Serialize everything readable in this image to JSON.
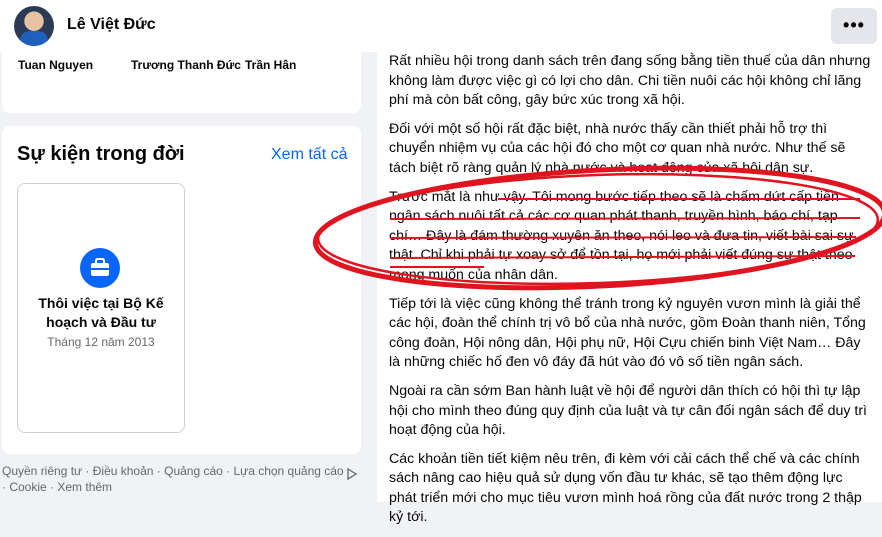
{
  "header": {
    "profile_name": "Lê Việt Đức",
    "more_label": "•••"
  },
  "friends": [
    "Tuan Nguyen",
    "Trương Thanh Đức",
    "Trần Hân"
  ],
  "life_events": {
    "title": "Sự kiện trong đời",
    "see_all": "Xem tất cả",
    "event": {
      "title": "Thôi việc tại Bộ Kế hoạch và Đầu tư",
      "date": "Tháng 12 năm 2013"
    }
  },
  "footer": {
    "line1": "Quyền riêng tư · Điều khoản · Quảng cáo · Lựa chọn quảng cáo",
    "line2": "· Cookie · Xem thêm"
  },
  "article": {
    "p1": "Rất nhiều hội trong danh sách trên đang sống bằng tiền thuế của dân nhưng không làm được việc gì có lợi cho dân. Chi tiền nuôi các hội không chỉ lãng phí mà còn bất công, gây bức xúc trong xã hội.",
    "p2": "Đối với một số hội rất đặc biệt, nhà nước thấy cần thiết phải hỗ trợ thì chuyển nhiệm vụ của các hội đó cho một cơ quan nhà nước. Như thế sẽ tách biệt rõ ràng quản lý nhà nước và hoạt động của xã hội dân sự.",
    "p3": "Trước mắt là như vậy. Tôi mong bước tiếp theo sẽ là chấm dứt cấp tiền ngân sách nuôi tất cả các cơ quan phát thanh, truyền hình, báo chí, tạp chí… Đây là đám thường xuyên ăn theo, nói leo và đưa tin, viết bài sai sự thật. Chỉ khi phải tự xoay sở để tồn tại, họ mới phải viết đúng sự thật theo mong muốn của nhân dân.",
    "p4": "Tiếp tới là việc cũng không thể tránh trong kỷ nguyên vươn mình là giải thể các hội, đoàn thể chính trị vô bổ của nhà nước, gồm Đoàn thanh niên, Tổng công đoàn, Hội nông dân, Hội phụ nữ, Hội Cựu chiến binh Việt Nam… Đây là những chiếc hố đen vô đáy đã hút vào đó vô số tiền ngân sách.",
    "p5": "Ngoài ra cần sớm Ban hành luật về hội để người dân thích có hội thì tự lập hội cho mình theo đúng quy định của luật và tự cân đối ngân sách để duy trì hoạt động của hội.",
    "p6": "Các khoản tiền tiết kiệm nêu trên, đi kèm với cải cách thể chế và các chính sách nâng cao hiệu quả sử dụng vốn đầu tư khác, sẽ tạo thêm động lực phát triển mới cho mục tiêu vươn mình hoá rồng của đất nước trong 2 thập kỷ tới."
  },
  "colors": {
    "accent": "#0866ff",
    "annotation": "#e0141e"
  },
  "icons": {
    "event": "briefcase-icon",
    "ad_choices": "ad-choices-icon"
  }
}
